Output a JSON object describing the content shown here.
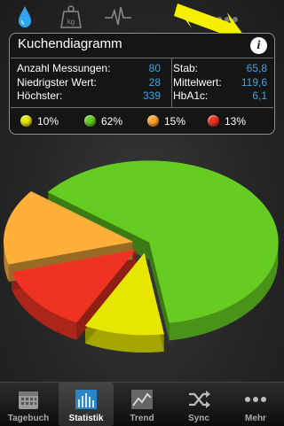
{
  "top_icons": [
    "water-drop-icon",
    "weight-kg-icon",
    "pulse-icon"
  ],
  "weight_icon_text": "kg",
  "panel": {
    "title": "Kuchendiagramm",
    "info_symbol": "i",
    "left_stats": [
      {
        "label": "Anzahl Messungen:",
        "value": "80"
      },
      {
        "label": "Niedrigster Wert:",
        "value": "28"
      },
      {
        "label": "Höchster:",
        "value": "339"
      }
    ],
    "right_stats": [
      {
        "label": "Stab:",
        "value": "65,8"
      },
      {
        "label": "Mittelwert:",
        "value": "119,6"
      },
      {
        "label": "HbA1c:",
        "value": "6,1"
      }
    ]
  },
  "chart_data": {
    "type": "pie",
    "slices": [
      {
        "value": 10,
        "label": "10%",
        "color": "#e6e600"
      },
      {
        "value": 62,
        "label": "62%",
        "color": "#66cc22"
      },
      {
        "value": 15,
        "label": "15%",
        "color": "#ffb03a"
      },
      {
        "value": 13,
        "label": "13%",
        "color": "#ee3322"
      }
    ],
    "legend_placement": "top",
    "style": "3d-exploded"
  },
  "tabs": [
    {
      "label": "Tagebuch",
      "icon": "calendar-icon",
      "active": false
    },
    {
      "label": "Statistik",
      "icon": "bar-chart-icon",
      "active": true
    },
    {
      "label": "Trend",
      "icon": "trend-line-icon",
      "active": false
    },
    {
      "label": "Sync",
      "icon": "shuffle-sync-icon",
      "active": false
    },
    {
      "label": "Mehr",
      "icon": "more-dots-icon",
      "active": false
    }
  ],
  "colors": {
    "accent_value": "#3aa6e8",
    "annotation_arrow": "#f5f000"
  }
}
